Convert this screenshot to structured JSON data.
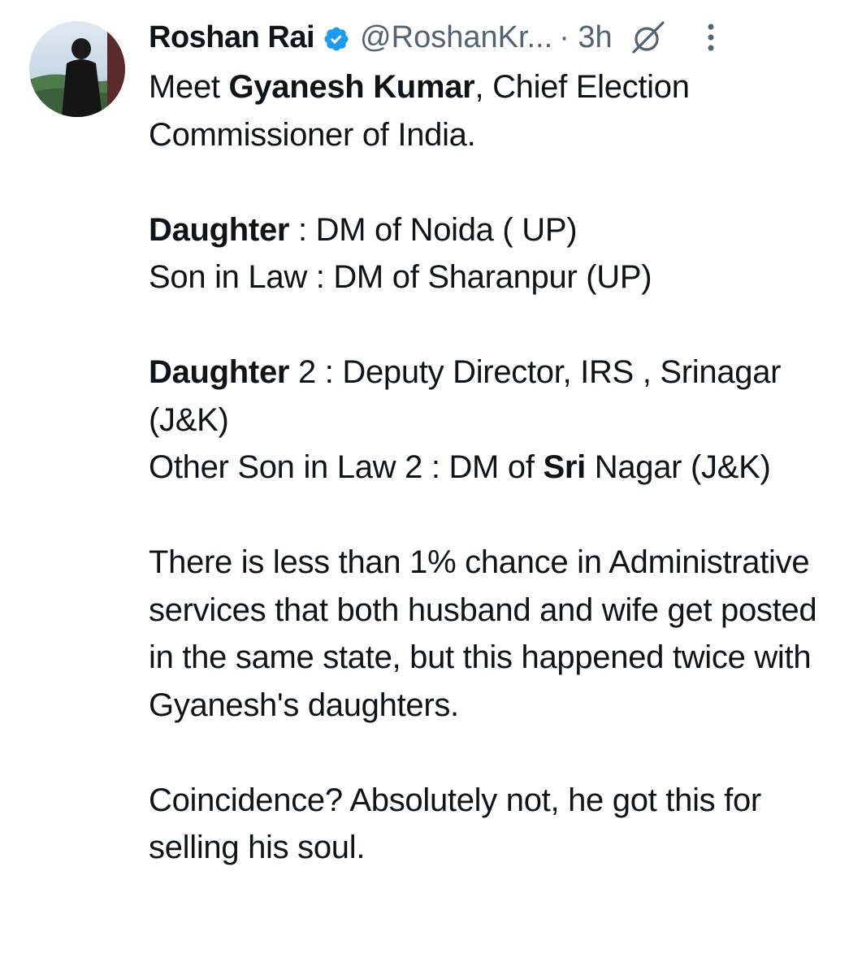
{
  "author": {
    "name": "Roshan Rai",
    "handle": "@RoshanKr...",
    "time": "· 3h",
    "verified_color": "#1d9bf0"
  },
  "icons": {
    "verified": "verified-badge-icon",
    "grok": "grok-icon",
    "more": "more-options-icon"
  },
  "tweet": {
    "p1": {
      "pre": "Meet ",
      "bold": "Gyanesh Kumar",
      "post": ", Chief Election Commissioner of India."
    },
    "p2a": {
      "bold": "Daughter",
      "post": " : DM of Noida ( UP)"
    },
    "p2b": "Son in Law : DM of Sharanpur (UP)",
    "p3a": {
      "bold": "Daughter",
      "post": " 2 : Deputy Director, IRS , Srinagar (J&K)"
    },
    "p3b": {
      "pre": "Other Son in Law 2 : DM of ",
      "bold": "Sri",
      "post": " Nagar (J&K)"
    },
    "p4": "There is less than 1% chance in Administrative services that both husband and wife get posted in the same state, but this happened twice with Gyanesh's daughters.",
    "p5": "Coincidence? Absolutely not, he got this for selling his soul."
  }
}
